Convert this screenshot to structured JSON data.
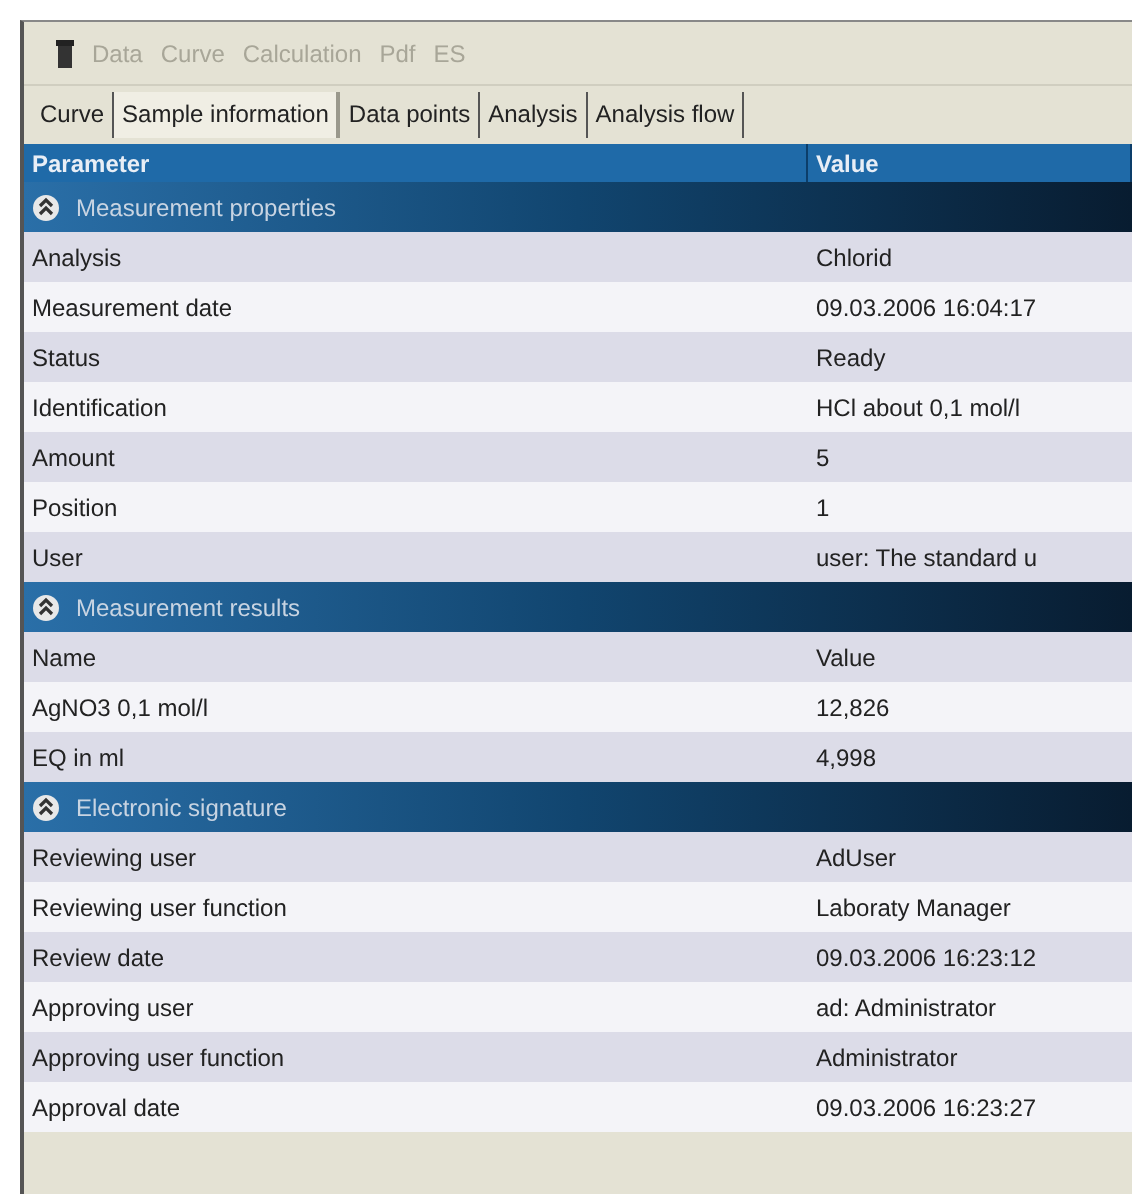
{
  "toolbar": {
    "items": [
      {
        "label": "Data",
        "disabled": true
      },
      {
        "label": "Curve",
        "disabled": true
      },
      {
        "label": "Calculation",
        "disabled": true
      },
      {
        "label": "Pdf",
        "disabled": true
      },
      {
        "label": "ES",
        "disabled": true
      }
    ]
  },
  "tabs": [
    {
      "label": "Curve",
      "selected": false
    },
    {
      "label": "Sample information",
      "selected": true
    },
    {
      "label": "Data points",
      "selected": false
    },
    {
      "label": "Analysis",
      "selected": false
    },
    {
      "label": "Analysis flow",
      "selected": false
    }
  ],
  "table": {
    "columns": [
      "Parameter",
      "Value"
    ],
    "sections": [
      {
        "title": "Measurement properties",
        "expanded": true,
        "rows": [
          [
            "Analysis",
            "Chlorid"
          ],
          [
            "Measurement date",
            "09.03.2006 16:04:17"
          ],
          [
            "Status",
            "Ready"
          ],
          [
            "Identification",
            "HCl about 0,1 mol/l"
          ],
          [
            "Amount",
            "5"
          ],
          [
            "Position",
            "1"
          ],
          [
            "User",
            "user: The standard u"
          ]
        ]
      },
      {
        "title": "Measurement results",
        "expanded": true,
        "rows": [
          [
            "Name",
            "Value"
          ],
          [
            "AgNO3 0,1 mol/l",
            "12,826"
          ],
          [
            "EQ in ml",
            "4,998"
          ]
        ]
      },
      {
        "title": "Electronic signature",
        "expanded": true,
        "rows": [
          [
            "Reviewing user",
            "AdUser"
          ],
          [
            "Reviewing user function",
            "Laboraty Manager"
          ],
          [
            "Review date",
            "09.03.2006 16:23:12"
          ],
          [
            "Approving user",
            "ad: Administrator"
          ],
          [
            "Approving user function",
            "Administrator"
          ],
          [
            "Approval date",
            "09.03.2006 16:23:27"
          ]
        ]
      }
    ]
  }
}
